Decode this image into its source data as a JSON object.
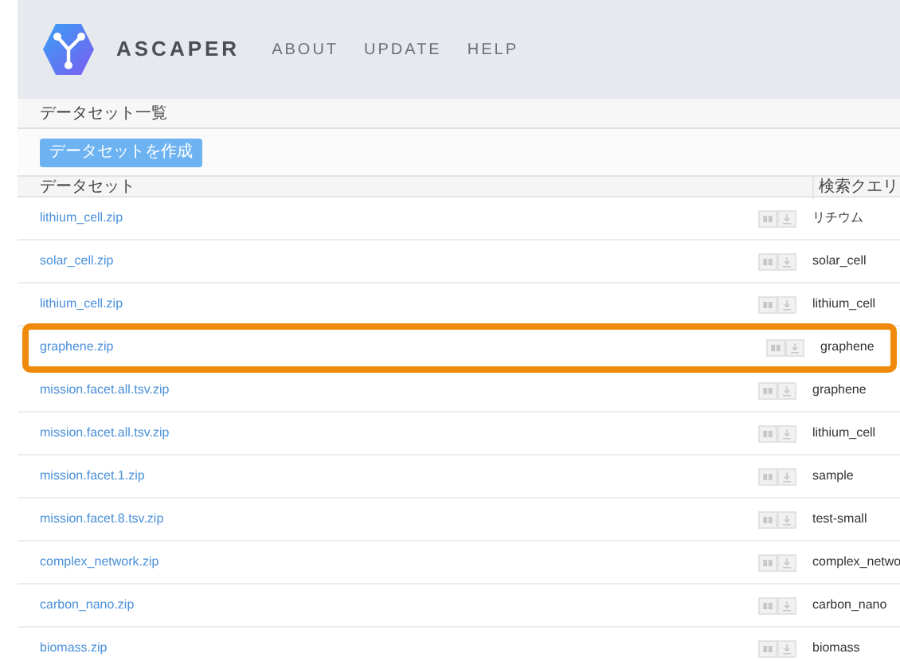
{
  "header": {
    "brand": "ASCAPER",
    "nav": [
      "ABOUT",
      "UPDATE",
      "HELP"
    ]
  },
  "breadcrumb": "データセット一覧",
  "create_button": "データセットを作成",
  "table": {
    "columns": [
      "データセット",
      "検索クエリ"
    ],
    "rows": [
      {
        "dataset": "lithium_cell.zip",
        "query": "リチウム",
        "highlighted": false
      },
      {
        "dataset": "solar_cell.zip",
        "query": "solar_cell",
        "highlighted": false
      },
      {
        "dataset": "lithium_cell.zip",
        "query": "lithium_cell",
        "highlighted": false
      },
      {
        "dataset": "graphene.zip",
        "query": "graphene",
        "highlighted": true
      },
      {
        "dataset": "mission.facet.all.tsv.zip",
        "query": "graphene",
        "highlighted": false
      },
      {
        "dataset": "mission.facet.all.tsv.zip",
        "query": "lithium_cell",
        "highlighted": false
      },
      {
        "dataset": "mission.facet.1.zip",
        "query": "sample",
        "highlighted": false
      },
      {
        "dataset": "mission.facet.8.tsv.zip",
        "query": "test-small",
        "highlighted": false
      },
      {
        "dataset": "complex_network.zip",
        "query": "complex_netwo",
        "highlighted": false
      },
      {
        "dataset": "carbon_nano.zip",
        "query": "carbon_nano",
        "highlighted": false
      },
      {
        "dataset": "biomass.zip",
        "query": "biomass",
        "highlighted": false
      }
    ]
  }
}
